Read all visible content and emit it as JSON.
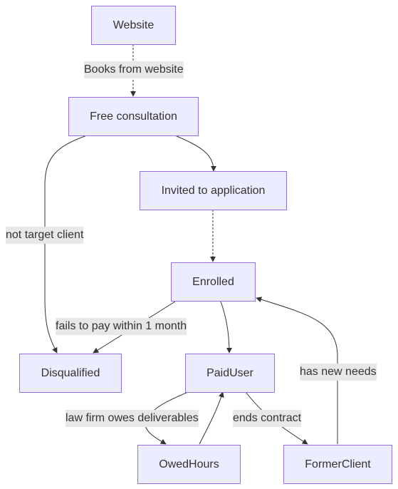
{
  "diagram": {
    "type": "flowchart",
    "direction": "top-down",
    "colors": {
      "node_fill": "#ECECFF",
      "node_border": "#9370DB",
      "text": "#333333",
      "edge": "#333333",
      "edge_label_bg": "#E8E8E8"
    },
    "nodes": {
      "website": "Website",
      "free_consultation": "Free consultation",
      "invited": "Invited to application",
      "enrolled": "Enrolled",
      "disqualified": "Disqualified",
      "paid_user": "PaidUser",
      "owed_hours": "OwedHours",
      "former_client": "FormerClient"
    },
    "edges": [
      {
        "from": "Website",
        "to": "Free consultation",
        "label": "Books from website"
      },
      {
        "from": "Free consultation",
        "to": "Invited to application",
        "label": ""
      },
      {
        "from": "Free consultation",
        "to": "Disqualified",
        "label": "not target client"
      },
      {
        "from": "Invited to application",
        "to": "Enrolled",
        "label": ""
      },
      {
        "from": "Enrolled",
        "to": "Disqualified",
        "label": "fails to pay within 1 month"
      },
      {
        "from": "Enrolled",
        "to": "PaidUser",
        "label": ""
      },
      {
        "from": "PaidUser",
        "to": "OwedHours",
        "label": "law firm owes deliverables"
      },
      {
        "from": "OwedHours",
        "to": "PaidUser",
        "label": ""
      },
      {
        "from": "PaidUser",
        "to": "FormerClient",
        "label": "ends contract"
      },
      {
        "from": "FormerClient",
        "to": "Enrolled",
        "label": "has new needs"
      }
    ]
  }
}
